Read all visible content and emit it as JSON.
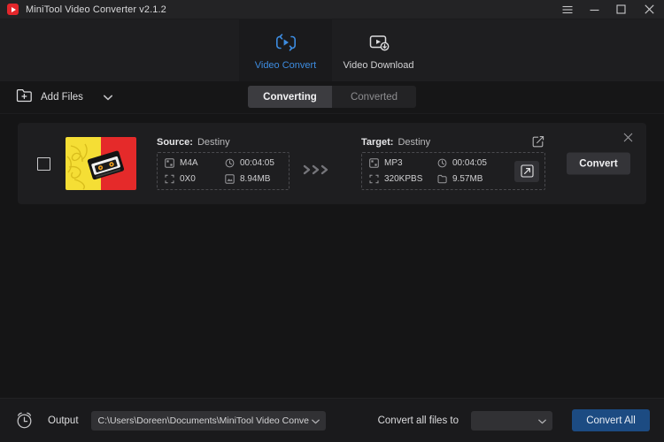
{
  "window": {
    "title": "MiniTool Video Converter v2.1.2",
    "logo_icon": "play-logo-icon",
    "controls": {
      "menu": "hamburger-menu-icon",
      "minimize": "minimize-icon",
      "maximize": "maximize-icon",
      "close": "close-icon"
    }
  },
  "nav": {
    "tabs": [
      {
        "label": "Video Convert",
        "icon": "video-convert-icon",
        "active": true
      },
      {
        "label": "Video Download",
        "icon": "video-download-icon",
        "active": false
      }
    ]
  },
  "toolbar": {
    "add_files_label": "Add Files",
    "add_files_icon": "folder-plus-icon",
    "add_files_caret": "chevron-down-icon",
    "segments": [
      {
        "label": "Converting",
        "active": true
      },
      {
        "label": "Converted",
        "active": false
      }
    ]
  },
  "file_card": {
    "checkbox_checked": false,
    "thumbnail_alt": "cassette-tape-thumbnail",
    "source": {
      "heading_label": "Source:",
      "name": "Destiny",
      "format": "M4A",
      "duration": "00:04:05",
      "resolution": "0X0",
      "size": "8.94MB"
    },
    "arrows_icon": "triple-chevron-right-icon",
    "target": {
      "heading_label": "Target:",
      "name": "Destiny",
      "format": "MP3",
      "duration": "00:04:05",
      "bitrate": "320KPBS",
      "size": "9.57MB",
      "edit_icon": "edit-square-icon",
      "preview_icon": "expand-arrow-icon"
    },
    "convert_button": "Convert",
    "close_icon": "close-icon"
  },
  "bottom": {
    "timer_icon": "alarm-clock-icon",
    "output_label": "Output",
    "output_path": "C:\\Users\\Doreen\\Documents\\MiniTool Video Converter\\outpu",
    "output_caret": "chevron-down-icon",
    "convert_all_files_to_label": "Convert all files to",
    "format_select_value": "",
    "format_caret": "chevron-down-icon",
    "convert_all_button": "Convert All"
  },
  "colors": {
    "accent_blue": "#3d8ce0",
    "button_blue": "#1c4b82",
    "logo_red": "#e3262b",
    "background": "#151516",
    "panel": "#1e1e20"
  }
}
